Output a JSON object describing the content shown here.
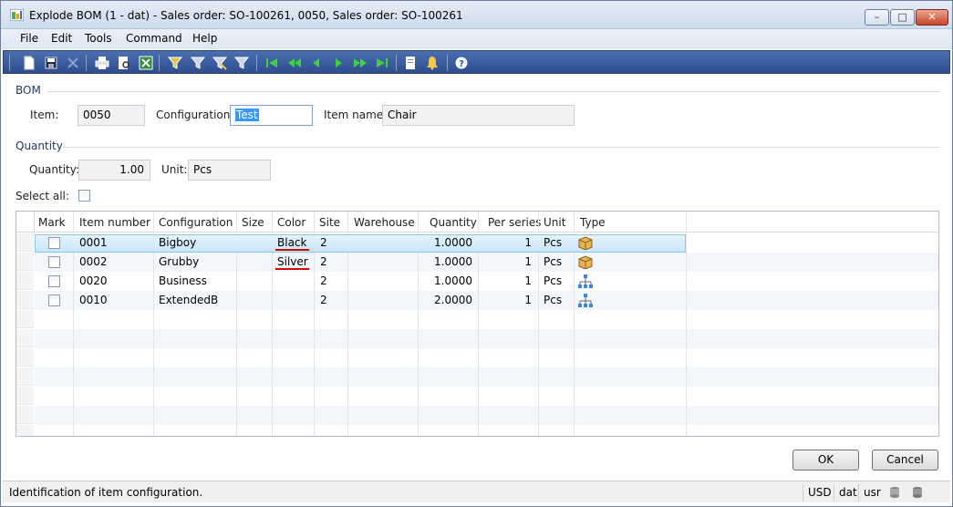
{
  "window": {
    "title": "Explode BOM (1 - dat) - Sales order: SO-100261, 0050, Sales order: SO-100261",
    "controls": {
      "minimize": "–",
      "maximize": "□",
      "close": "✕"
    }
  },
  "menu": [
    "File",
    "Edit",
    "Tools",
    "Command",
    "Help"
  ],
  "toolbar_icons": [
    "new-icon",
    "save-icon",
    "delete-icon",
    "print-icon",
    "print-preview-icon",
    "export-excel-icon",
    "filter-by-selection-icon",
    "filter-by-field-icon",
    "advanced-filter-icon",
    "remove-filter-icon",
    "first-record-icon",
    "previous-page-icon",
    "previous-record-icon",
    "next-record-icon",
    "next-page-icon",
    "last-record-icon",
    "document-handling-icon",
    "alert-icon",
    "help-icon"
  ],
  "bom": {
    "group_label": "BOM",
    "item_label": "Item:",
    "item_value": "0050",
    "configuration_label": "Configuration:",
    "configuration_value": "Test",
    "item_name_label": "Item name:",
    "item_name_value": "Chair"
  },
  "quantity": {
    "group_label": "Quantity",
    "quantity_label": "Quantity:",
    "quantity_value": "1.00",
    "unit_label": "Unit:",
    "unit_value": "Pcs"
  },
  "select_all_label": "Select all:",
  "grid": {
    "columns": [
      "Mark",
      "Item number",
      "Configuration",
      "Size",
      "Color",
      "Site",
      "Warehouse",
      "Quantity",
      "Per series",
      "Unit",
      "Type"
    ],
    "rows": [
      {
        "item": "0001",
        "config": "Bigboy",
        "size": "",
        "color": "Black",
        "site": "2",
        "warehouse": "",
        "qty": "1.0000",
        "per_series": "1",
        "unit": "Pcs",
        "type_icon": "item-box-icon"
      },
      {
        "item": "0002",
        "config": "Grubby",
        "size": "",
        "color": "Silver",
        "site": "2",
        "warehouse": "",
        "qty": "1.0000",
        "per_series": "1",
        "unit": "Pcs",
        "type_icon": "item-box-icon"
      },
      {
        "item": "0020",
        "config": "Business",
        "size": "",
        "color": "",
        "site": "2",
        "warehouse": "",
        "qty": "1.0000",
        "per_series": "1",
        "unit": "Pcs",
        "type_icon": "bom-tree-icon"
      },
      {
        "item": "0010",
        "config": "ExtendedB",
        "size": "",
        "color": "",
        "site": "2",
        "warehouse": "",
        "qty": "2.0000",
        "per_series": "1",
        "unit": "Pcs",
        "type_icon": "bom-tree-icon"
      }
    ]
  },
  "buttons": {
    "ok": "OK",
    "cancel": "Cancel"
  },
  "statusbar": {
    "message": "Identification of item configuration.",
    "currency": "USD",
    "company": "dat",
    "user": "usr"
  }
}
